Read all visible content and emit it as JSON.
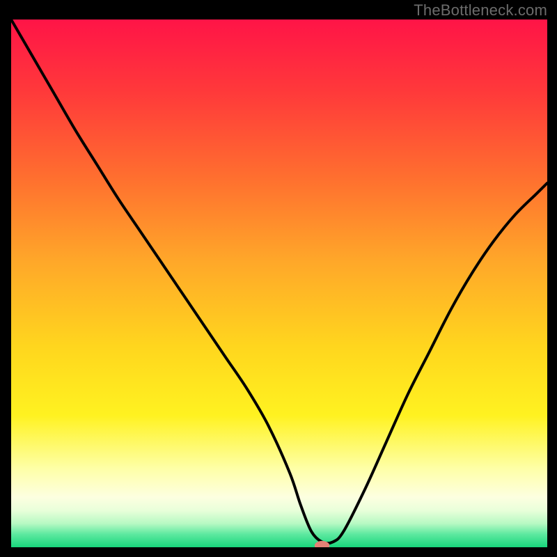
{
  "watermark": "TheBottleneck.com",
  "chart_data": {
    "type": "line",
    "title": "",
    "xlabel": "",
    "ylabel": "",
    "xlim": [
      0,
      100
    ],
    "ylim": [
      0,
      100
    ],
    "background_gradient": {
      "stops": [
        {
          "t": 0.0,
          "color": "#ff1447"
        },
        {
          "t": 0.14,
          "color": "#ff3a3a"
        },
        {
          "t": 0.3,
          "color": "#ff6f2f"
        },
        {
          "t": 0.46,
          "color": "#ffa829"
        },
        {
          "t": 0.62,
          "color": "#ffd61e"
        },
        {
          "t": 0.75,
          "color": "#fff220"
        },
        {
          "t": 0.85,
          "color": "#feffa6"
        },
        {
          "t": 0.905,
          "color": "#fdffe0"
        },
        {
          "t": 0.93,
          "color": "#e9ffda"
        },
        {
          "t": 0.955,
          "color": "#b7f9c3"
        },
        {
          "t": 0.975,
          "color": "#5ee9a0"
        },
        {
          "t": 1.0,
          "color": "#18d67b"
        }
      ]
    },
    "series": [
      {
        "name": "bottleneck-curve",
        "x": [
          0,
          4,
          8,
          12,
          16,
          20,
          24,
          28,
          32,
          36,
          40,
          44,
          48,
          52,
          54,
          56,
          58,
          60,
          62,
          66,
          70,
          74,
          78,
          82,
          86,
          90,
          94,
          98,
          100
        ],
        "y": [
          100,
          93,
          86,
          79,
          72.5,
          66,
          60,
          54,
          48,
          42,
          36,
          30,
          23,
          14,
          8,
          3,
          1,
          1,
          3,
          11,
          20,
          29,
          37,
          45,
          52,
          58,
          63,
          67,
          69
        ]
      }
    ],
    "marker": {
      "name": "optimal-point",
      "x": 58,
      "y": 0.3,
      "color": "#e48176",
      "rx": 1.4,
      "ry": 0.9
    }
  }
}
